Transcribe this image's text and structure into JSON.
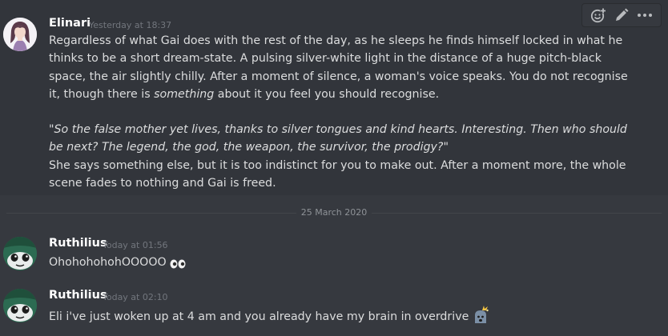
{
  "messages": [
    {
      "author": "Elinari",
      "timestamp": "Yesterday at 18:37",
      "p1_a": "Regardless of what Gai does with the rest of the day, as he sleeps he finds himself locked in what he thinks to be a short dream-state. A pulsing silver-white light in the distance of a huge pitch-black space, the air slightly chilly. After a moment of silence, a woman's voice speaks. You do not recognise it, though there is ",
      "p1_em": "something",
      "p1_b": " about it you feel you should recognise.",
      "quote": "\"So the false mother yet lives, thanks to silver tongues and kind hearts. Interesting. Then who should be next? The legend, the god, the weapon, the survivor, the prodigy?\"",
      "p2": "She says something else, but it is too indistinct for you to make out. After a moment more, the whole scene fades to nothing and Gai is freed."
    },
    {
      "author": "Ruthilius",
      "timestamp": "Today at 01:56",
      "text": "OhohohohohOOOOO"
    },
    {
      "author": "Ruthilius",
      "timestamp": "Today at 02:10",
      "text": "Eli i've just woken up at 4 am and you already have my brain in overdrive"
    }
  ],
  "date_divider": "25 March 2020",
  "toolbar": {
    "icons": [
      "add-reaction-icon",
      "edit-pencil-icon",
      "more-options-icon"
    ]
  },
  "colors": {
    "background": "#36393f",
    "hover": "#32353b",
    "username": "#ffffff",
    "timestamp": "#72767d",
    "text": "#dcddde"
  }
}
